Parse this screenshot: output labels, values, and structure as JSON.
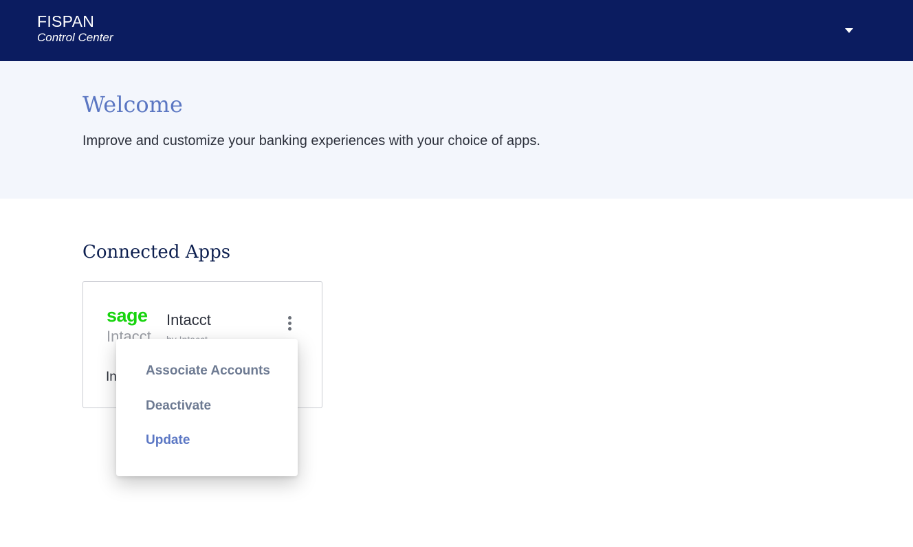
{
  "header": {
    "brand_name": "FISPAN",
    "brand_subtitle": "Control Center",
    "user_menu_icon": "chevron-down-icon"
  },
  "hero": {
    "title": "Welcome",
    "description": "Improve and customize your banking experiences with your choice of apps."
  },
  "connected_apps": {
    "title": "Connected Apps",
    "apps": [
      {
        "logo_primary": "sage",
        "logo_secondary": "Intacct",
        "name": "Intacct",
        "vendor": "by Intacct",
        "description": "In",
        "more_icon": "more-vertical-icon"
      }
    ]
  },
  "app_menu": {
    "items": [
      "Associate Accounts",
      "Deactivate",
      "Update"
    ]
  },
  "colors": {
    "header_bg": "#0b1c60",
    "hero_bg": "#f3f6fc",
    "accent": "#5a76c2",
    "sage_green": "#17d40e",
    "menu_text": "#6d7a92"
  }
}
